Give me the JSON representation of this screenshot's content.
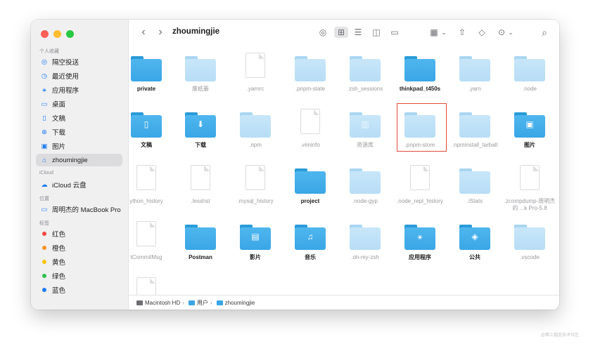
{
  "window": {
    "title": "zhoumingjie"
  },
  "sidebar": {
    "favorites_title": "个人收藏",
    "favorites": [
      {
        "label": "隔空投送",
        "icon": "airdrop-icon"
      },
      {
        "label": "最近使用",
        "icon": "clock-icon"
      },
      {
        "label": "应用程序",
        "icon": "applications-icon"
      },
      {
        "label": "桌面",
        "icon": "desktop-icon"
      },
      {
        "label": "文稿",
        "icon": "document-icon"
      },
      {
        "label": "下载",
        "icon": "download-icon"
      },
      {
        "label": "图片",
        "icon": "pictures-icon"
      },
      {
        "label": "zhoumingjie",
        "icon": "home-icon"
      }
    ],
    "icloud_title": "iCloud",
    "icloud": [
      {
        "label": "iCloud 云盘",
        "icon": "cloud-icon"
      }
    ],
    "locations_title": "位置",
    "locations": [
      {
        "label": "周明杰的 MacBook Pro",
        "icon": "laptop-icon"
      }
    ],
    "tags_title": "标签",
    "tags": [
      {
        "label": "红色",
        "color": "#f2473f"
      },
      {
        "label": "橙色",
        "color": "#f7931e"
      },
      {
        "label": "黄色",
        "color": "#f5c400"
      },
      {
        "label": "绿色",
        "color": "#2fbf4a"
      },
      {
        "label": "蓝色",
        "color": "#1f7cf2"
      }
    ]
  },
  "toolbar": {
    "back": "‹",
    "forward": "›",
    "airdrop_glyph": "◎",
    "grid_view_glyph": "⊞",
    "list_view_glyph": "☰",
    "column_view_glyph": "◫",
    "gallery_view_glyph": "▭",
    "group_glyph": "▦",
    "share_glyph": "⇧",
    "tag_glyph": "◇",
    "more_glyph": "⊙",
    "chevron_glyph": "⌄",
    "search_glyph": "⌕"
  },
  "files": [
    {
      "name": "private",
      "kind": "folder-blue",
      "hidden": false
    },
    {
      "name": "废纸篓",
      "kind": "folder-light",
      "hidden": true
    },
    {
      "name": ".yarnrc",
      "kind": "doc",
      "hidden": true
    },
    {
      "name": ".pnpm-state",
      "kind": "folder-light",
      "hidden": true
    },
    {
      "name": ".zsh_sessions",
      "kind": "folder-light",
      "hidden": true
    },
    {
      "name": "thinkpad_t450s",
      "kind": "folder-blue",
      "hidden": false
    },
    {
      "name": ".yarn",
      "kind": "folder-light",
      "hidden": true
    },
    {
      "name": ".node",
      "kind": "folder-light",
      "hidden": true
    },
    {
      "name": "文稿",
      "kind": "folder-blue",
      "hidden": false,
      "glyph": "▯"
    },
    {
      "name": "下载",
      "kind": "folder-blue",
      "hidden": false,
      "glyph": "⬇"
    },
    {
      "name": ".npm",
      "kind": "folder-light",
      "hidden": true
    },
    {
      "name": ".viminfo",
      "kind": "doc",
      "hidden": true
    },
    {
      "name": "资源库",
      "kind": "folder-light",
      "hidden": true,
      "glyph": "▥"
    },
    {
      "name": ".pnpm-store",
      "kind": "folder-light",
      "hidden": true,
      "selected": true
    },
    {
      "name": ".npminstall_tarball",
      "kind": "folder-light",
      "hidden": true
    },
    {
      "name": "图片",
      "kind": "folder-blue",
      "hidden": false,
      "glyph": "▣"
    },
    {
      "name": "ython_history",
      "kind": "doc",
      "hidden": true
    },
    {
      "name": ".lesshst",
      "kind": "doc",
      "hidden": true
    },
    {
      "name": ".mysql_history",
      "kind": "doc",
      "hidden": true
    },
    {
      "name": "project",
      "kind": "folder-blue",
      "hidden": false
    },
    {
      "name": ".node-gyp",
      "kind": "folder-light",
      "hidden": true
    },
    {
      "name": ".node_repl_history",
      "kind": "doc",
      "hidden": true
    },
    {
      "name": ".iStats",
      "kind": "folder-light",
      "hidden": true
    },
    {
      "name": ".zcompdump-周明杰的 ...k Pro-5.8",
      "kind": "doc",
      "hidden": true
    },
    {
      "name": "tCommitMsg",
      "kind": "doc",
      "hidden": true
    },
    {
      "name": "Postman",
      "kind": "folder-blue",
      "hidden": false
    },
    {
      "name": "影片",
      "kind": "folder-blue",
      "hidden": false,
      "glyph": "▤"
    },
    {
      "name": "音乐",
      "kind": "folder-blue",
      "hidden": false,
      "glyph": "♫"
    },
    {
      "name": ".oh-my-zsh",
      "kind": "folder-light",
      "hidden": true
    },
    {
      "name": "应用程序",
      "kind": "folder-blue",
      "hidden": false,
      "glyph": "⚹"
    },
    {
      "name": "公共",
      "kind": "folder-blue",
      "hidden": false,
      "glyph": "◈"
    },
    {
      "name": ".vscode",
      "kind": "folder-light",
      "hidden": true
    },
    {
      "name": "",
      "kind": "doc",
      "hidden": true
    }
  ],
  "path_bar": [
    {
      "label": "Macintosh HD",
      "color": "#6e6e73"
    },
    {
      "label": "用户",
      "color": "#3aa6e6"
    },
    {
      "label": "zhoumingjie",
      "color": "#3aa6e6"
    }
  ],
  "path_separator": "›",
  "watermark": "@稀土掘金技术社区"
}
